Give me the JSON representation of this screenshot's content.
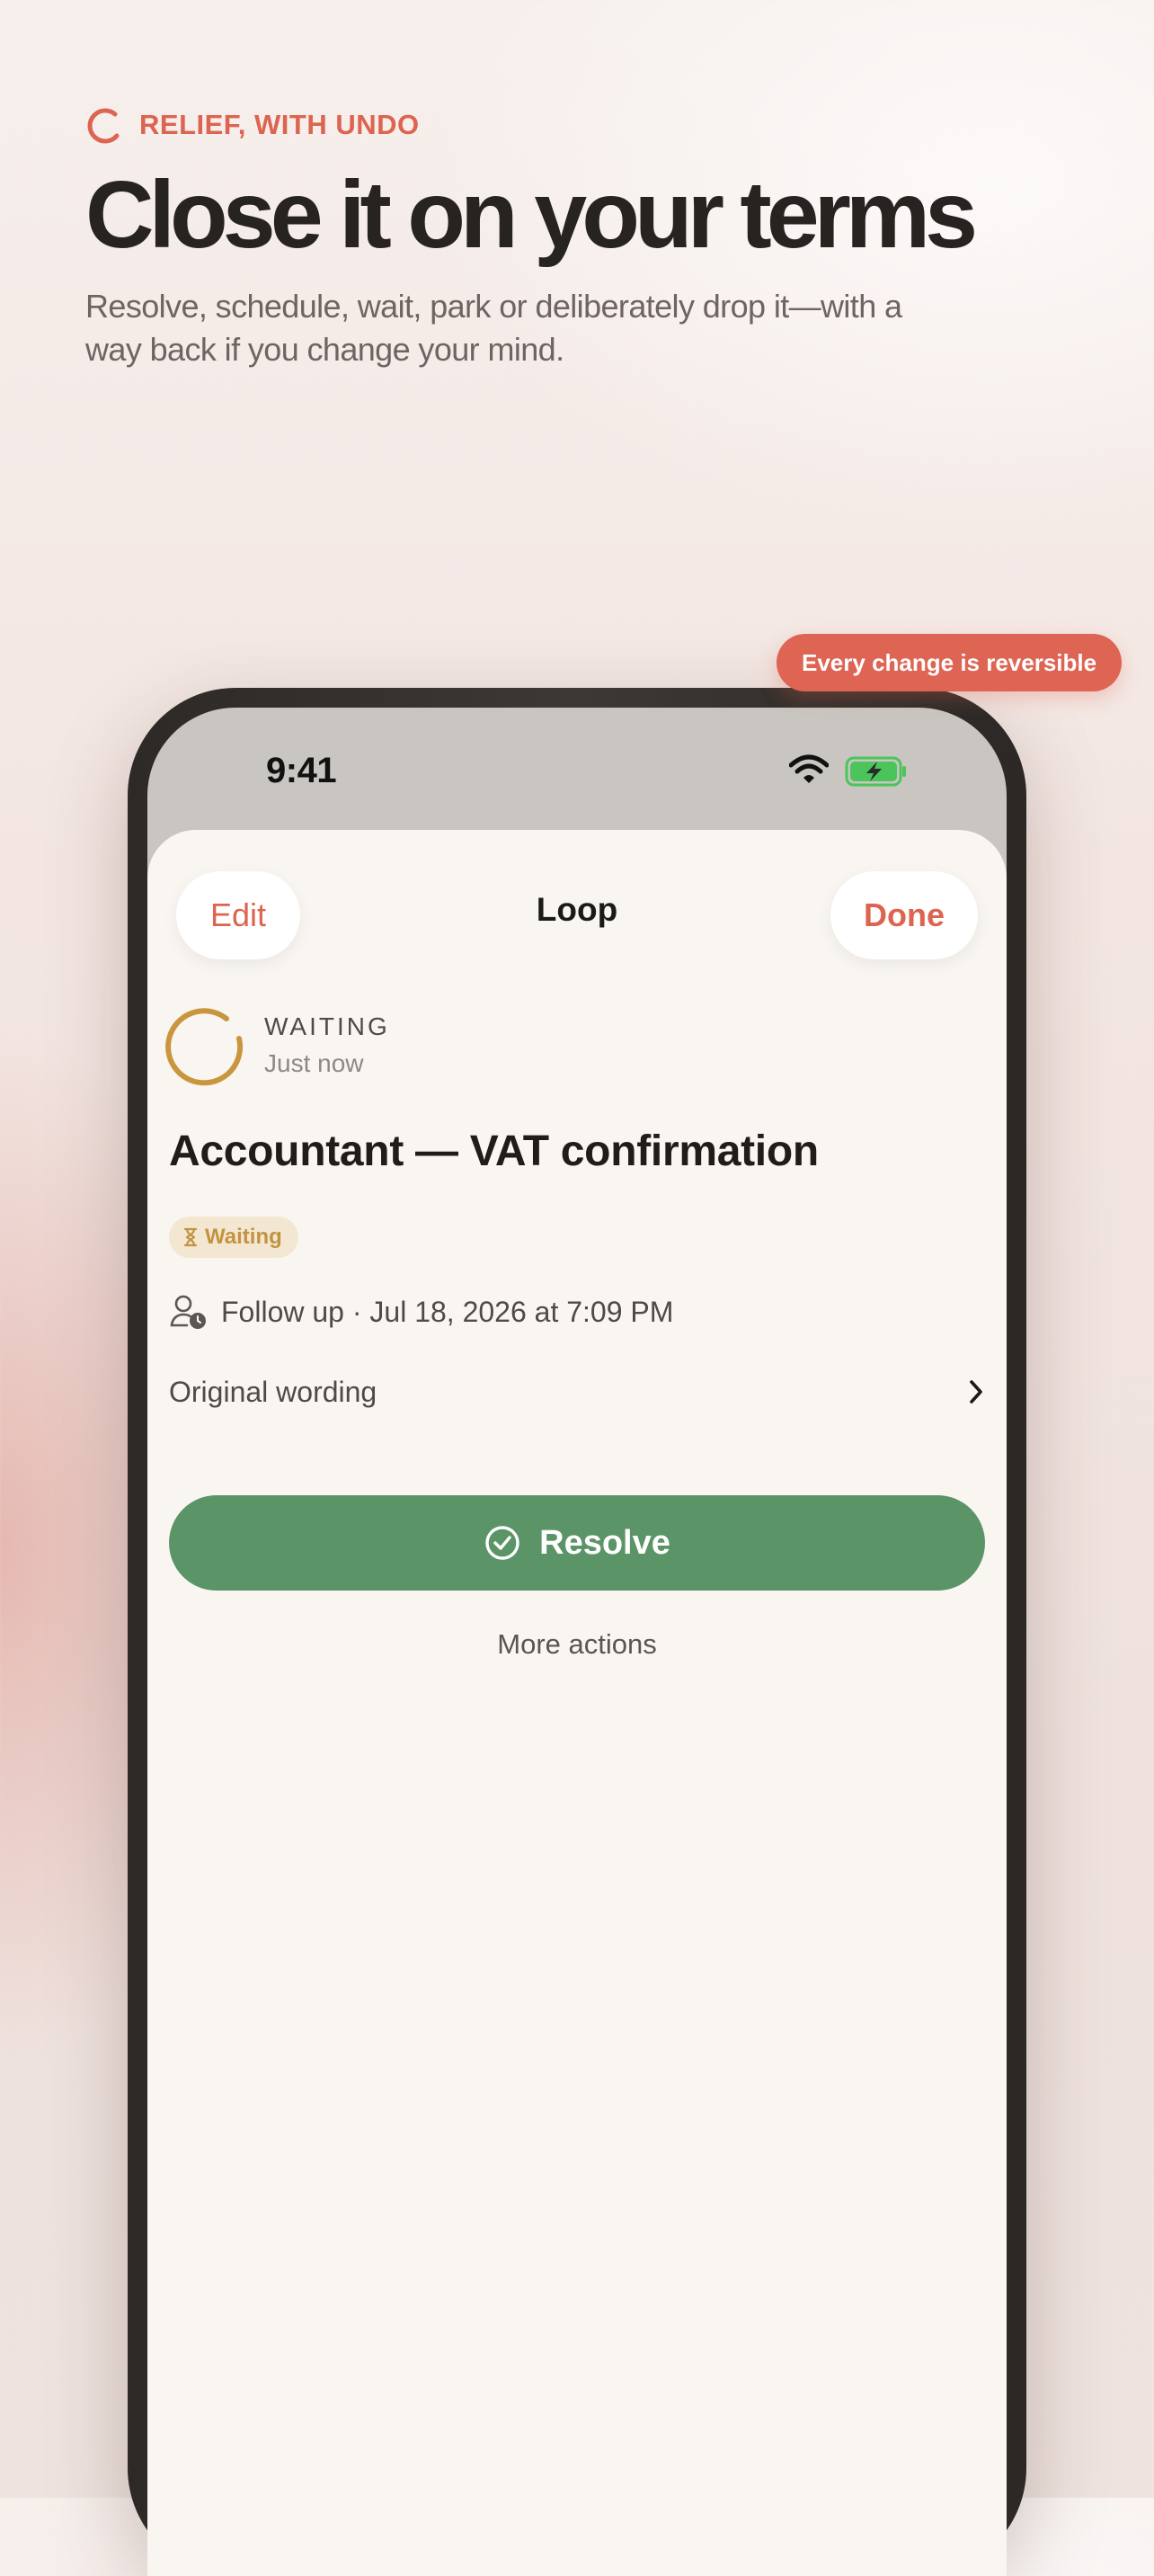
{
  "hero": {
    "eyebrow": "RELIEF, WITH UNDO",
    "headline": "Close it on your terms",
    "subhead": "Resolve, schedule, wait, park or deliberately drop it—with a way back if you change your mind."
  },
  "pill_label": "Every change is reversible",
  "status_bar": {
    "time": "9:41",
    "battery_charging": true
  },
  "nav": {
    "edit_label": "Edit",
    "title": "Loop",
    "done_label": "Done"
  },
  "loop": {
    "state_label": "WAITING",
    "state_time": "Just now",
    "title": "Accountant — VAT confirmation",
    "badge_label": "Waiting",
    "follow_up": "Follow up · Jul 18, 2026 at 7:09 PM",
    "original_wording_label": "Original wording"
  },
  "actions": {
    "resolve_label": "Resolve",
    "more_label": "More actions"
  },
  "colors": {
    "accent": "#dc6450",
    "waiting": "#c39342",
    "resolve": "#5b9466",
    "battery": "#4cc45c"
  },
  "icons": [
    "loop-ring-icon",
    "wifi-icon",
    "battery-icon",
    "hourglass-icon",
    "person-clock-icon",
    "chevron-right-icon",
    "check-circle-icon"
  ]
}
